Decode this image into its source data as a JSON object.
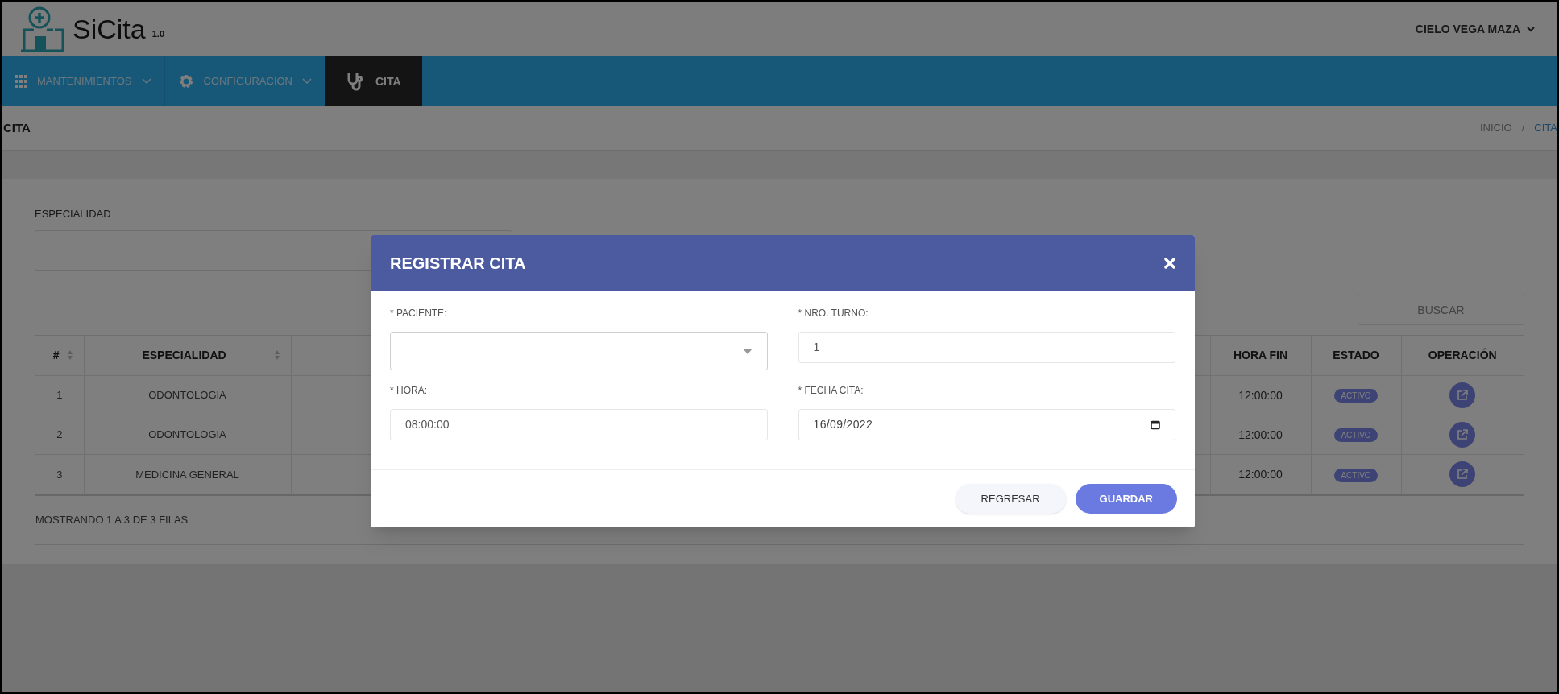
{
  "header": {
    "logo_text": "SiCita",
    "version": "1.0",
    "user": "CIELO VEGA MAZA"
  },
  "nav": [
    {
      "label": "MANTENIMIENTOS",
      "kind": "grid",
      "dropdown": true,
      "selected": false
    },
    {
      "label": "CONFIGURACION",
      "kind": "gear",
      "dropdown": true,
      "selected": false
    },
    {
      "label": "CITA",
      "kind": "stethoscope",
      "dropdown": false,
      "selected": true
    }
  ],
  "page_title": "CITA",
  "breadcrumb": {
    "separator": "/",
    "items": [
      {
        "label": "INICIO",
        "current": false
      },
      {
        "label": "CITA",
        "current": true
      }
    ]
  },
  "filter": {
    "label": "ESPECIALIDAD"
  },
  "search": {
    "placeholder": "BUSCAR"
  },
  "table": {
    "left_columns": [
      {
        "label": "#",
        "sortable": true
      },
      {
        "label": "ESPECIALIDAD",
        "sortable": true
      }
    ],
    "right_columns": [
      {
        "label": "HORA FIN",
        "sortable": false
      },
      {
        "label": "ESTADO",
        "sortable": false
      },
      {
        "label": "OPERACIÓN",
        "sortable": false
      }
    ],
    "rows": [
      {
        "number": "1",
        "especialidad": "ODONTOLOGIA",
        "hora_fin": "12:00:00",
        "estado": "ACTIVO"
      },
      {
        "number": "2",
        "especialidad": "ODONTOLOGIA",
        "hora_fin": "12:00:00",
        "estado": "ACTIVO"
      },
      {
        "number": "3",
        "especialidad": "MEDICINA GENERAL",
        "hora_fin": "12:00:00",
        "estado": "ACTIVO"
      }
    ],
    "footer": "MOSTRANDO 1 A 3 DE 3 FILAS"
  },
  "modal": {
    "title": "REGISTRAR CITA",
    "fields": [
      {
        "label": "* PACIENTE:",
        "kind": "select"
      },
      {
        "label": "* NRO. TURNO:",
        "kind": "text",
        "value": "1"
      },
      {
        "label": "* HORA:",
        "kind": "text",
        "value": "08:00:00"
      },
      {
        "label": "* FECHA CITA:",
        "kind": "date",
        "value": "16/09/2022"
      }
    ],
    "buttons": [
      {
        "label": "REGRESAR",
        "primary": false
      },
      {
        "label": "GUARDAR",
        "primary": true
      }
    ]
  }
}
